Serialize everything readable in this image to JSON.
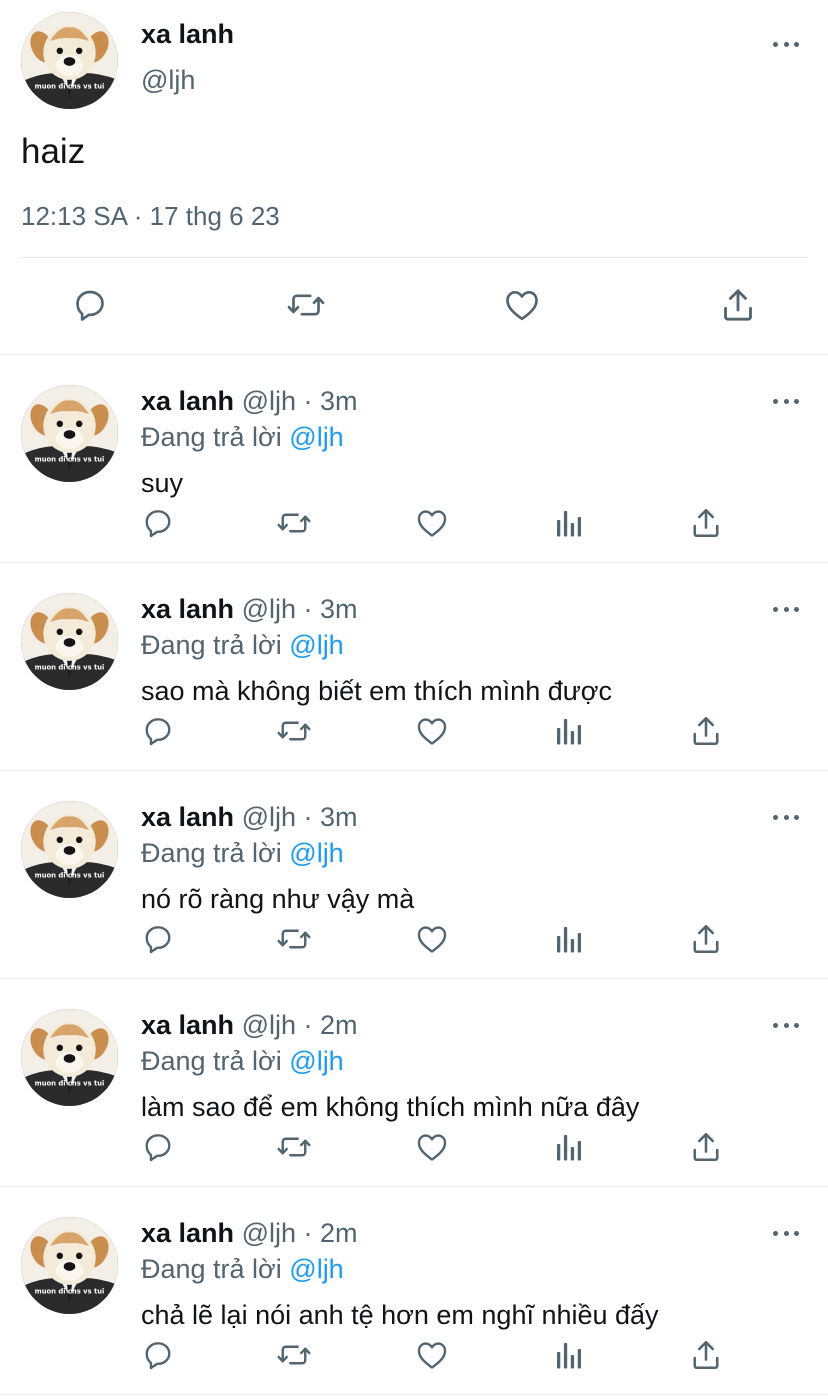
{
  "main_tweet": {
    "display_name": "xa lanh",
    "handle": "@ljh",
    "text": "haiz",
    "timestamp": "12:13 SA · 17 thg 6 23",
    "avatar_caption": "muon di chs vs tui",
    "actions": [
      "reply-icon",
      "retweet-icon",
      "like-icon",
      "share-icon"
    ]
  },
  "colors": {
    "primary_text": "#0f1419",
    "secondary_text": "#536471",
    "accent": "#1d9bf0",
    "divider": "#e6e9ec"
  },
  "replies": [
    {
      "display_name": "xa lanh",
      "handle": "@ljh",
      "dot": "·",
      "time": "3m",
      "replying_prefix": "Đang trả lời",
      "mention": "@ljh",
      "text": "suy"
    },
    {
      "display_name": "xa lanh",
      "handle": "@ljh",
      "dot": "·",
      "time": "3m",
      "replying_prefix": "Đang trả lời",
      "mention": "@ljh",
      "text": "sao mà không biết em thích mình được"
    },
    {
      "display_name": "xa lanh",
      "handle": "@ljh",
      "dot": "·",
      "time": "3m",
      "replying_prefix": "Đang trả lời",
      "mention": "@ljh",
      "text": "nó rõ ràng như vậy mà"
    },
    {
      "display_name": "xa lanh",
      "handle": "@ljh",
      "dot": "·",
      "time": "2m",
      "replying_prefix": "Đang trả lời",
      "mention": "@ljh",
      "text": "làm sao để em không thích mình nữa đây"
    },
    {
      "display_name": "xa lanh",
      "handle": "@ljh",
      "dot": "·",
      "time": "2m",
      "replying_prefix": "Đang trả lời",
      "mention": "@ljh",
      "text": "chả lẽ lại nói anh tệ hơn em nghĩ nhiều đấy"
    }
  ],
  "reply_actions": [
    "reply-icon",
    "retweet-icon",
    "like-icon",
    "views-icon",
    "share-icon"
  ]
}
